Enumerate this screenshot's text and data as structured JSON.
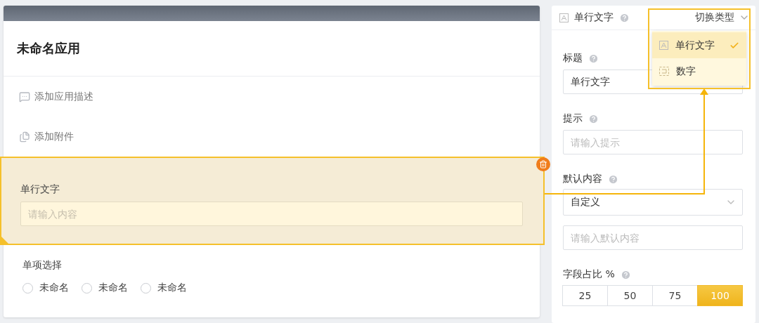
{
  "app_title": "未命名应用",
  "actions": [
    {
      "kind": "description",
      "label": "添加应用描述"
    },
    {
      "kind": "attachment",
      "label": "添加附件"
    }
  ],
  "form_fields": [
    {
      "kind": "text",
      "label": "单行文字",
      "placeholder": "请输入内容",
      "selected": true
    },
    {
      "kind": "radio",
      "label": "单项选择",
      "selected": false,
      "options": [
        {
          "label": "未命名",
          "checked": false
        },
        {
          "label": "未命名",
          "checked": false
        },
        {
          "label": "未命名",
          "checked": false
        }
      ]
    }
  ],
  "properties": {
    "field_type": "单行文字",
    "switch_label": "切换类型",
    "type_menu": [
      {
        "kind": "text",
        "label": "单行文字",
        "selected": true
      },
      {
        "kind": "number",
        "label": "数字",
        "selected": false
      }
    ],
    "title_label": "标题",
    "title_value": "单行文字",
    "hint_label": "提示",
    "hint_placeholder": "请输入提示",
    "default_label": "默认内容",
    "default_select": "自定义",
    "default_placeholder": "请输入默认内容",
    "width_label": "字段占比 %",
    "width_options": [
      {
        "label": "25",
        "selected": false
      },
      {
        "label": "50",
        "selected": false
      },
      {
        "label": "75",
        "selected": false
      },
      {
        "label": "100",
        "selected": true
      }
    ]
  }
}
